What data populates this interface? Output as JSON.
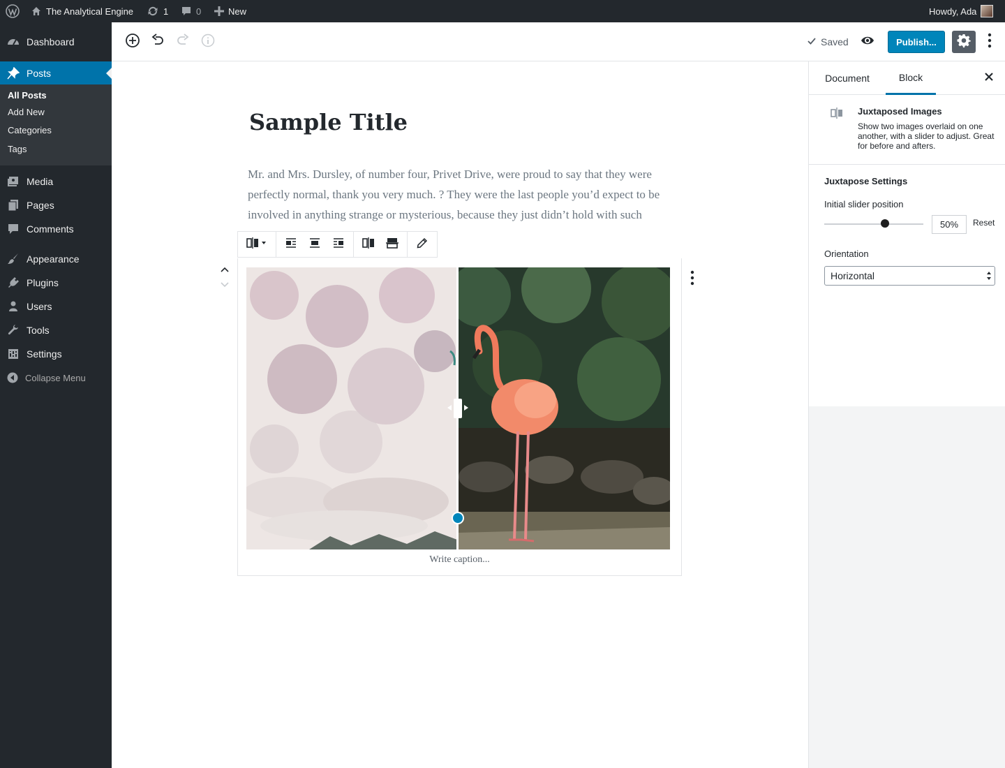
{
  "adminbar": {
    "site_name": "The Analytical Engine",
    "updates_count": "1",
    "comments_count": "0",
    "new_label": "New",
    "greeting": "Howdy, Ada"
  },
  "menu": {
    "items": [
      {
        "label": "Dashboard",
        "icon": "dashboard-icon"
      },
      {
        "label": "Posts",
        "icon": "pin-icon"
      },
      {
        "label": "Media",
        "icon": "media-icon"
      },
      {
        "label": "Pages",
        "icon": "pages-icon"
      },
      {
        "label": "Comments",
        "icon": "comments-icon"
      },
      {
        "label": "Appearance",
        "icon": "appearance-icon"
      },
      {
        "label": "Plugins",
        "icon": "plugins-icon"
      },
      {
        "label": "Users",
        "icon": "users-icon"
      },
      {
        "label": "Tools",
        "icon": "tools-icon"
      },
      {
        "label": "Settings",
        "icon": "settings-icon"
      }
    ],
    "submenu": [
      "All Posts",
      "Add New",
      "Categories",
      "Tags"
    ],
    "collapse_label": "Collapse Menu"
  },
  "header": {
    "saved_label": "Saved",
    "publish_label": "Publish..."
  },
  "post": {
    "title": "Sample Title",
    "paragraph": "Mr. and Mrs. Dursley, of number four, Privet Drive, were proud to say that they were perfectly normal, thank you very much. ? They were the last people you’d expect to be involved in anything strange or mysterious, because they just didn’t hold with such nonsense."
  },
  "block": {
    "caption_placeholder": "Write caption..."
  },
  "sidebar": {
    "tabs": [
      "Document",
      "Block"
    ],
    "active_tab": "Block",
    "block_title": "Juxtaposed Images",
    "block_description": "Show two images overlaid on one another, with a slider to adjust. Great for before and afters.",
    "panel_title": "Juxtapose Settings",
    "slider_label": "Initial slider position",
    "slider_value": "50%",
    "slider_fraction": 0.5,
    "reset_label": "Reset",
    "orientation_label": "Orientation",
    "orientation_value": "Horizontal"
  },
  "colors": {
    "admin_bg": "#23282d",
    "accent": "#0073aa",
    "publish": "#0085ba"
  }
}
